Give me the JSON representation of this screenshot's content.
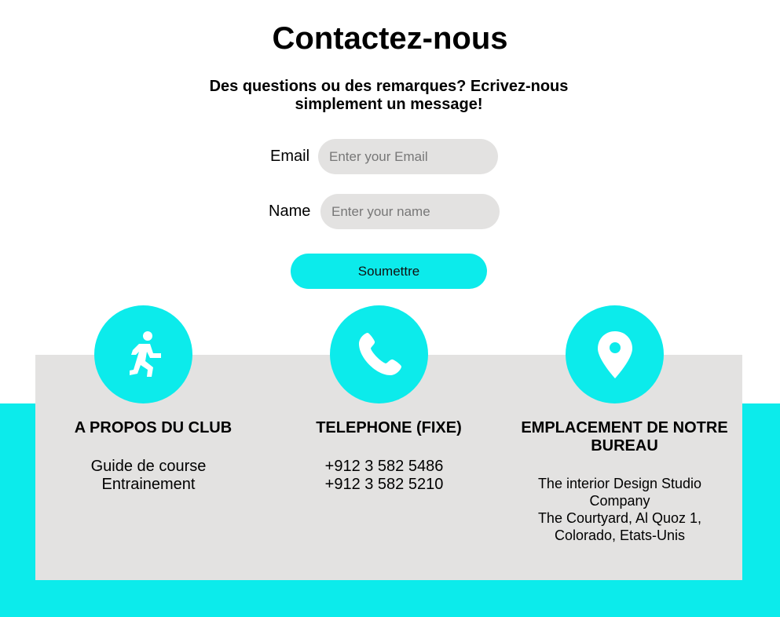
{
  "page": {
    "title": "Contactez-nous",
    "subtitle": "Des questions ou des remarques? Ecrivez-nous simplement un message!"
  },
  "form": {
    "email_label": "Email",
    "email_placeholder": "Enter your Email",
    "name_label": "Name",
    "name_placeholder": "Enter your name",
    "submit_label": "Soumettre"
  },
  "footer": {
    "about": {
      "icon": "running-person-icon",
      "heading": "A PROPOS DU CLUB",
      "lines": [
        "Guide de course",
        "Entrainement"
      ]
    },
    "phone": {
      "icon": "phone-icon",
      "heading": "TELEPHONE (FIXE)",
      "lines": [
        "+912 3 582 5486",
        "+912 3 582 5210"
      ]
    },
    "location": {
      "icon": "map-pin-icon",
      "heading": "EMPLACEMENT DE NOTRE BUREAU",
      "lines": [
        "The interior Design Studio Company",
        "The Courtyard, Al Quoz 1, Colorado, Etats-Unis"
      ]
    }
  },
  "colors": {
    "accent": "#0cebeb",
    "panel": "#e3e2e1",
    "input_bg": "#e3e2e1",
    "text": "#000000"
  }
}
